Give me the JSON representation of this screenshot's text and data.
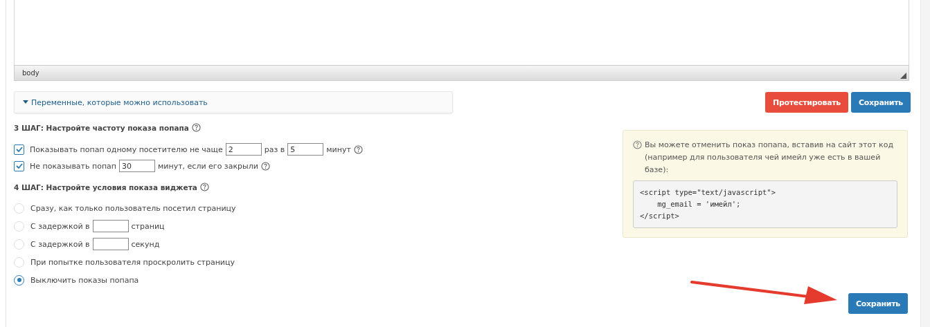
{
  "editor": {
    "status_path": "body"
  },
  "variables_panel": {
    "label": "Переменные, которые можно использовать"
  },
  "toolbar_buttons": [
    {
      "label": "Протестировать",
      "kind": "danger"
    },
    {
      "label": "Сохранить",
      "kind": "primary"
    }
  ],
  "step3": {
    "title": "3 ШАГ: Настройте частоту показа попапа",
    "options": [
      {
        "checked": true,
        "parts": [
          {
            "kind": "text",
            "text": "Показывать попап одному посетителю не чаще"
          },
          {
            "kind": "field",
            "value": "2"
          },
          {
            "kind": "text",
            "text": "раз в"
          },
          {
            "kind": "field",
            "value": "5"
          },
          {
            "kind": "text",
            "text": "минут"
          },
          {
            "kind": "help"
          }
        ]
      },
      {
        "checked": true,
        "parts": [
          {
            "kind": "text",
            "text": "Не показывать попап"
          },
          {
            "kind": "field",
            "value": "30"
          },
          {
            "kind": "text",
            "text": "минут, если его закрыли"
          },
          {
            "kind": "help"
          }
        ]
      }
    ]
  },
  "step4": {
    "title": "4 ШАГ: Настройте условия показа виджета",
    "options": [
      {
        "selected": false,
        "parts": [
          {
            "kind": "text",
            "text": "Сразу, как только пользователь посетил страницу"
          }
        ]
      },
      {
        "selected": false,
        "parts": [
          {
            "kind": "text",
            "text": "С задержкой в"
          },
          {
            "kind": "field"
          },
          {
            "kind": "text",
            "text": "страниц"
          }
        ]
      },
      {
        "selected": false,
        "parts": [
          {
            "kind": "text",
            "text": "С задержкой в"
          },
          {
            "kind": "field"
          },
          {
            "kind": "text",
            "text": "секунд"
          }
        ]
      },
      {
        "selected": false,
        "parts": [
          {
            "kind": "text",
            "text": "При попытке пользователя проскролить страницу"
          }
        ]
      },
      {
        "selected": true,
        "parts": [
          {
            "kind": "text",
            "text": "Выключить показы попапа"
          }
        ]
      }
    ]
  },
  "note": {
    "text": "Вы можете отменить показ попапа, вставив на сайт этот код (например для пользователя чей имейл уже есть в вашей базе):",
    "code": [
      "<script type=\"text/javascript\">",
      "    mg_email = 'имейл';",
      "</script>"
    ]
  },
  "bottom_button": {
    "label": "Сохранить"
  }
}
